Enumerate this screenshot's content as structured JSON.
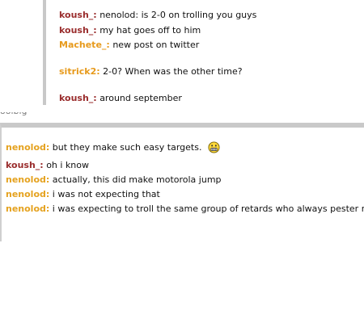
{
  "top_chat": [
    {
      "nick": "koush_:",
      "text": "nenolod: is 2-0 on trolling you guys"
    },
    {
      "nick": "koush_:",
      "text": "my hat goes off to him"
    },
    {
      "nick": "Machete_:",
      "text": "new post on twitter"
    },
    {
      "nick": "sitrick2:",
      "text": "2-0? When was the other time?"
    },
    {
      "nick": "koush_:",
      "text": "around september"
    }
  ],
  "divider_text": "oolbig",
  "main_chat": [
    {
      "nick": "nenolod:",
      "text": "but they make such easy targets."
    },
    {
      "nick": "koush_:",
      "text": "oh i know"
    },
    {
      "nick": "nenolod:",
      "text": "actually, this did make motorola jump"
    },
    {
      "nick": "nenolod:",
      "text": "i was not expecting that"
    },
    {
      "nick": "nenolod:",
      "text": "i was expecting to troll the same group of retards who always pester me"
    }
  ],
  "emoticon": "grimace-emoticon-icon",
  "colors": {
    "koush": "#9a2d2d",
    "nenolod": "#e5a21f",
    "machete": "#e79a1c",
    "sitrick": "#e79a1c",
    "panel_border": "#c9c9c9"
  }
}
